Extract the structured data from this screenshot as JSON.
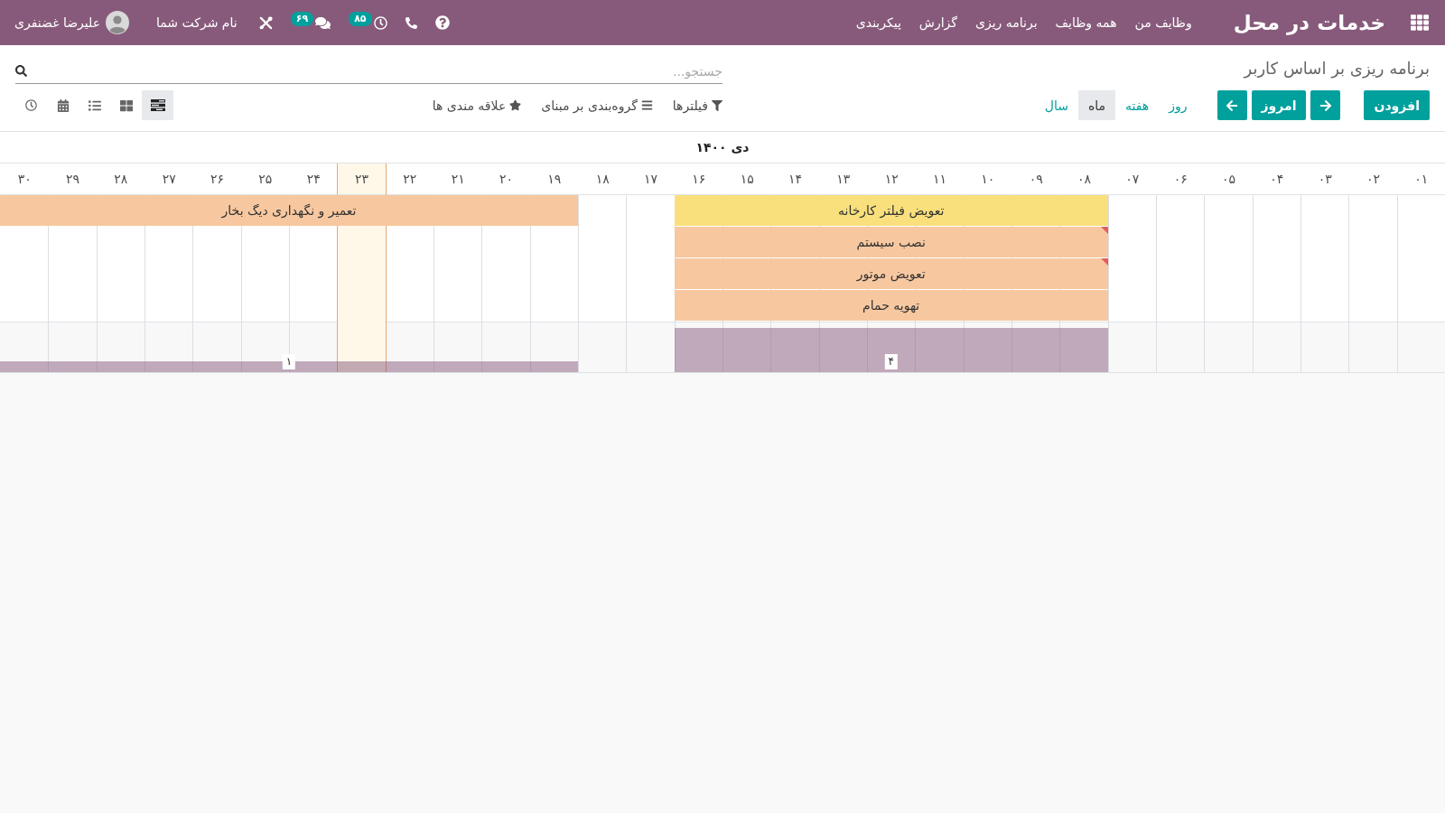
{
  "navbar": {
    "brand": "خدمات در محل",
    "menu": [
      {
        "label": "وظایف من"
      },
      {
        "label": "همه وظایف"
      },
      {
        "label": "برنامه ریزی"
      },
      {
        "label": "گزارش"
      },
      {
        "label": "پیکربندی"
      }
    ],
    "systray": {
      "activities_badge": "۸۵",
      "messages_badge": "۶۹"
    },
    "company": "نام شرکت شما",
    "user": {
      "name": "علیرضا غضنفری"
    }
  },
  "control_panel": {
    "breadcrumb": "برنامه ریزی بر اساس کاربر",
    "search": {
      "placeholder": "جستجو..."
    },
    "create_button": "افزودن",
    "today_button": "امروز",
    "scales": [
      {
        "label": "روز",
        "selected": false
      },
      {
        "label": "هفته",
        "selected": false
      },
      {
        "label": "ماه",
        "selected": true
      },
      {
        "label": "سال",
        "selected": false
      }
    ],
    "search_options": [
      {
        "kind": "filters",
        "label": "فیلترها"
      },
      {
        "kind": "group_by",
        "label": "گروه‌بندی بر مبنای"
      },
      {
        "kind": "favorites",
        "label": "علاقه مندی ها"
      }
    ],
    "views": [
      {
        "kind": "gantt",
        "selected": true
      },
      {
        "kind": "kanban",
        "selected": false
      },
      {
        "kind": "list",
        "selected": false
      },
      {
        "kind": "calendar",
        "selected": false
      },
      {
        "kind": "activity",
        "selected": false
      }
    ]
  },
  "gantt": {
    "title": "دی ۱۴۰۰",
    "days": [
      {
        "label": "۰۱",
        "today": false
      },
      {
        "label": "۰۲",
        "today": false
      },
      {
        "label": "۰۳",
        "today": false
      },
      {
        "label": "۰۴",
        "today": false
      },
      {
        "label": "۰۵",
        "today": false
      },
      {
        "label": "۰۶",
        "today": false
      },
      {
        "label": "۰۷",
        "today": false
      },
      {
        "label": "۰۸",
        "today": false
      },
      {
        "label": "۰۹",
        "today": false
      },
      {
        "label": "۱۰",
        "today": false
      },
      {
        "label": "۱۱",
        "today": false
      },
      {
        "label": "۱۲",
        "today": false
      },
      {
        "label": "۱۳",
        "today": false
      },
      {
        "label": "۱۴",
        "today": false
      },
      {
        "label": "۱۵",
        "today": false
      },
      {
        "label": "۱۶",
        "today": false
      },
      {
        "label": "۱۷",
        "today": false
      },
      {
        "label": "۱۸",
        "today": false
      },
      {
        "label": "۱۹",
        "today": false
      },
      {
        "label": "۲۰",
        "today": false
      },
      {
        "label": "۲۱",
        "today": false
      },
      {
        "label": "۲۲",
        "today": false
      },
      {
        "label": "۲۳",
        "today": true
      },
      {
        "label": "۲۴",
        "today": false
      },
      {
        "label": "۲۵",
        "today": false
      },
      {
        "label": "۲۶",
        "today": false
      },
      {
        "label": "۲۷",
        "today": false
      },
      {
        "label": "۲۸",
        "today": false
      },
      {
        "label": "۲۹",
        "today": false
      },
      {
        "label": "۳۰",
        "today": false
      }
    ],
    "lanes": [
      {
        "slots": [
          {
            "kind": "empty"
          },
          {
            "kind": "empty"
          },
          {
            "kind": "empty"
          },
          {
            "kind": "empty"
          },
          {
            "kind": "empty"
          },
          {
            "kind": "empty"
          },
          {
            "kind": "empty"
          },
          {
            "kind": "pill",
            "name": "تعویض فیلتر کارخانه",
            "color": "#f9e07c",
            "warning": false
          },
          {
            "kind": "covered"
          },
          {
            "kind": "covered"
          },
          {
            "kind": "covered"
          },
          {
            "kind": "covered"
          },
          {
            "kind": "covered"
          },
          {
            "kind": "covered"
          },
          {
            "kind": "covered"
          },
          {
            "kind": "covered"
          },
          {
            "kind": "empty"
          },
          {
            "kind": "empty"
          },
          {
            "kind": "pill",
            "name": "تعمیر و نگهداری دیگ بخار",
            "color": "#f7c8a0",
            "warning": false
          },
          {
            "kind": "covered"
          },
          {
            "kind": "covered"
          },
          {
            "kind": "covered"
          },
          {
            "kind": "covered"
          },
          {
            "kind": "covered"
          },
          {
            "kind": "covered"
          },
          {
            "kind": "covered"
          },
          {
            "kind": "covered"
          },
          {
            "kind": "covered"
          },
          {
            "kind": "covered"
          },
          {
            "kind": "covered"
          }
        ]
      },
      {
        "slots": [
          {
            "kind": "empty"
          },
          {
            "kind": "empty"
          },
          {
            "kind": "empty"
          },
          {
            "kind": "empty"
          },
          {
            "kind": "empty"
          },
          {
            "kind": "empty"
          },
          {
            "kind": "empty"
          },
          {
            "kind": "pill",
            "name": "نصب سیستم",
            "color": "#f7c8a0",
            "warning": true
          },
          {
            "kind": "covered"
          },
          {
            "kind": "covered"
          },
          {
            "kind": "covered"
          },
          {
            "kind": "covered"
          },
          {
            "kind": "covered"
          },
          {
            "kind": "covered"
          },
          {
            "kind": "covered"
          },
          {
            "kind": "covered"
          },
          {
            "kind": "empty"
          },
          {
            "kind": "empty"
          },
          {
            "kind": "empty"
          },
          {
            "kind": "empty"
          },
          {
            "kind": "empty"
          },
          {
            "kind": "empty"
          },
          {
            "kind": "empty"
          },
          {
            "kind": "empty"
          },
          {
            "kind": "empty"
          },
          {
            "kind": "empty"
          },
          {
            "kind": "empty"
          },
          {
            "kind": "empty"
          },
          {
            "kind": "empty"
          },
          {
            "kind": "empty"
          }
        ]
      },
      {
        "slots": [
          {
            "kind": "empty"
          },
          {
            "kind": "empty"
          },
          {
            "kind": "empty"
          },
          {
            "kind": "empty"
          },
          {
            "kind": "empty"
          },
          {
            "kind": "empty"
          },
          {
            "kind": "empty"
          },
          {
            "kind": "pill",
            "name": "تعویض موتور",
            "color": "#f7c8a0",
            "warning": true
          },
          {
            "kind": "covered"
          },
          {
            "kind": "covered"
          },
          {
            "kind": "covered"
          },
          {
            "kind": "covered"
          },
          {
            "kind": "covered"
          },
          {
            "kind": "covered"
          },
          {
            "kind": "covered"
          },
          {
            "kind": "covered"
          },
          {
            "kind": "empty"
          },
          {
            "kind": "empty"
          },
          {
            "kind": "empty"
          },
          {
            "kind": "empty"
          },
          {
            "kind": "empty"
          },
          {
            "kind": "empty"
          },
          {
            "kind": "empty"
          },
          {
            "kind": "empty"
          },
          {
            "kind": "empty"
          },
          {
            "kind": "empty"
          },
          {
            "kind": "empty"
          },
          {
            "kind": "empty"
          },
          {
            "kind": "empty"
          },
          {
            "kind": "empty"
          }
        ]
      },
      {
        "slots": [
          {
            "kind": "empty"
          },
          {
            "kind": "empty"
          },
          {
            "kind": "empty"
          },
          {
            "kind": "empty"
          },
          {
            "kind": "empty"
          },
          {
            "kind": "empty"
          },
          {
            "kind": "empty"
          },
          {
            "kind": "pill",
            "name": "تهویه حمام",
            "color": "#f7c8a0",
            "warning": false
          },
          {
            "kind": "covered"
          },
          {
            "kind": "covered"
          },
          {
            "kind": "covered"
          },
          {
            "kind": "covered"
          },
          {
            "kind": "covered"
          },
          {
            "kind": "covered"
          },
          {
            "kind": "covered"
          },
          {
            "kind": "covered"
          },
          {
            "kind": "empty"
          },
          {
            "kind": "empty"
          },
          {
            "kind": "empty"
          },
          {
            "kind": "empty"
          },
          {
            "kind": "empty"
          },
          {
            "kind": "empty"
          },
          {
            "kind": "empty"
          },
          {
            "kind": "empty"
          },
          {
            "kind": "empty"
          },
          {
            "kind": "empty"
          },
          {
            "kind": "empty"
          },
          {
            "kind": "empty"
          },
          {
            "kind": "empty"
          },
          {
            "kind": "empty"
          }
        ]
      }
    ],
    "totals": {
      "slots": [
        {
          "kind": "empty"
        },
        {
          "kind": "empty"
        },
        {
          "kind": "empty"
        },
        {
          "kind": "empty"
        },
        {
          "kind": "empty"
        },
        {
          "kind": "empty"
        },
        {
          "kind": "empty"
        },
        {
          "kind": "bar",
          "count": "۴"
        },
        {
          "kind": "covered"
        },
        {
          "kind": "covered"
        },
        {
          "kind": "covered"
        },
        {
          "kind": "covered"
        },
        {
          "kind": "covered"
        },
        {
          "kind": "covered"
        },
        {
          "kind": "covered"
        },
        {
          "kind": "covered"
        },
        {
          "kind": "empty"
        },
        {
          "kind": "empty"
        },
        {
          "kind": "bar",
          "count": "۱"
        },
        {
          "kind": "covered"
        },
        {
          "kind": "covered"
        },
        {
          "kind": "covered"
        },
        {
          "kind": "covered"
        },
        {
          "kind": "covered"
        },
        {
          "kind": "covered"
        },
        {
          "kind": "covered"
        },
        {
          "kind": "covered"
        },
        {
          "kind": "covered"
        },
        {
          "kind": "covered"
        },
        {
          "kind": "covered"
        }
      ]
    }
  }
}
